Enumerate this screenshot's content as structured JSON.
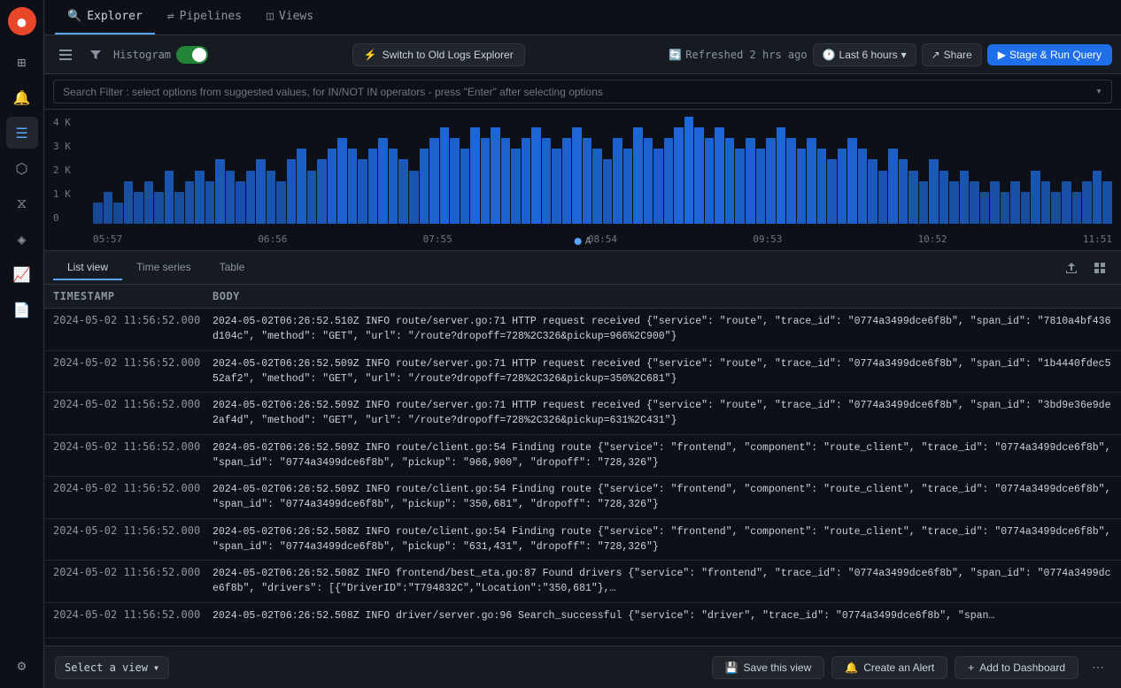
{
  "app": {
    "title": "Logs Explorer"
  },
  "sidebar": {
    "items": [
      {
        "id": "logo",
        "icon": "●",
        "label": "Logo"
      },
      {
        "id": "dashboard",
        "icon": "⊞",
        "label": "Dashboard"
      },
      {
        "id": "alerts",
        "icon": "🔔",
        "label": "Alerts"
      },
      {
        "id": "logs",
        "icon": "≡",
        "label": "Logs",
        "active": true
      },
      {
        "id": "metrics",
        "icon": "⬡",
        "label": "Metrics"
      },
      {
        "id": "traces",
        "icon": "⧖",
        "label": "Traces"
      },
      {
        "id": "analytics",
        "icon": "◈",
        "label": "Analytics"
      },
      {
        "id": "chart",
        "icon": "📈",
        "label": "Chart"
      },
      {
        "id": "docs",
        "icon": "📄",
        "label": "Docs"
      },
      {
        "id": "settings",
        "icon": "⚙",
        "label": "Settings"
      }
    ]
  },
  "top_tabs": [
    {
      "id": "explorer",
      "label": "Explorer",
      "icon": "🔍",
      "active": true
    },
    {
      "id": "pipelines",
      "label": "Pipelines",
      "icon": "⇌"
    },
    {
      "id": "views",
      "label": "Views",
      "icon": "◫"
    }
  ],
  "toolbar": {
    "histogram_label": "Histogram",
    "switch_btn": "Switch to Old Logs Explorer",
    "refresh_text": "Refreshed 2 hrs ago",
    "time_range": "Last 6 hours",
    "share_label": "Share",
    "run_query_label": "Stage & Run Query"
  },
  "search": {
    "placeholder": "Search Filter : select options from suggested values, for IN/NOT IN operators - press \"Enter\" after selecting options"
  },
  "histogram": {
    "y_labels": [
      "4 K",
      "3 K",
      "2 K",
      "1 K",
      "0"
    ],
    "x_labels": [
      "05:57",
      "06:56",
      "07:55",
      "08:54",
      "09:53",
      "10:52",
      "11:51"
    ],
    "legend_label": "A",
    "bars": [
      2,
      3,
      2,
      4,
      3,
      4,
      3,
      5,
      3,
      4,
      5,
      4,
      6,
      5,
      4,
      5,
      6,
      5,
      4,
      6,
      7,
      5,
      6,
      7,
      8,
      7,
      6,
      7,
      8,
      7,
      6,
      5,
      7,
      8,
      9,
      8,
      7,
      9,
      8,
      9,
      8,
      7,
      8,
      9,
      8,
      7,
      8,
      9,
      8,
      7,
      6,
      8,
      7,
      9,
      8,
      7,
      8,
      9,
      10,
      9,
      8,
      9,
      8,
      7,
      8,
      7,
      8,
      9,
      8,
      7,
      8,
      7,
      6,
      7,
      8,
      7,
      6,
      5,
      7,
      6,
      5,
      4,
      6,
      5,
      4,
      5,
      4,
      3,
      4,
      3,
      4,
      3,
      5,
      4,
      3,
      4,
      3,
      4,
      5,
      4
    ]
  },
  "view_tabs": [
    {
      "id": "list",
      "label": "List view",
      "active": true
    },
    {
      "id": "timeseries",
      "label": "Time series"
    },
    {
      "id": "table",
      "label": "Table"
    }
  ],
  "table": {
    "headers": [
      "Timestamp",
      "Body"
    ],
    "rows": [
      {
        "timestamp": "2024-05-02 11:56:52.000",
        "body": "2024-05-02T06:26:52.510Z INFO route/server.go:71 HTTP request received {\"service\": \"route\", \"trace_id\": \"0774a3499dce6f8b\", \"span_id\": \"7810a4bf436d104c\", \"method\": \"GET\", \"url\": \"/route?dropoff=728%2C326&pickup=966%2C900\"}"
      },
      {
        "timestamp": "2024-05-02 11:56:52.000",
        "body": "2024-05-02T06:26:52.509Z INFO route/server.go:71 HTTP request received {\"service\": \"route\", \"trace_id\": \"0774a3499dce6f8b\", \"span_id\": \"1b4440fdec552af2\", \"method\": \"GET\", \"url\": \"/route?dropoff=728%2C326&pickup=350%2C681\"}"
      },
      {
        "timestamp": "2024-05-02 11:56:52.000",
        "body": "2024-05-02T06:26:52.509Z INFO route/server.go:71 HTTP request received {\"service\": \"route\", \"trace_id\": \"0774a3499dce6f8b\", \"span_id\": \"3bd9e36e9de2af4d\", \"method\": \"GET\", \"url\": \"/route?dropoff=728%2C326&pickup=631%2C431\"}"
      },
      {
        "timestamp": "2024-05-02 11:56:52.000",
        "body": "2024-05-02T06:26:52.509Z INFO route/client.go:54 Finding route {\"service\": \"frontend\", \"component\": \"route_client\", \"trace_id\": \"0774a3499dce6f8b\", \"span_id\": \"0774a3499dce6f8b\", \"pickup\": \"966,900\", \"dropoff\": \"728,326\"}"
      },
      {
        "timestamp": "2024-05-02 11:56:52.000",
        "body": "2024-05-02T06:26:52.509Z INFO route/client.go:54 Finding route {\"service\": \"frontend\", \"component\": \"route_client\", \"trace_id\": \"0774a3499dce6f8b\", \"span_id\": \"0774a3499dce6f8b\", \"pickup\": \"350,681\", \"dropoff\": \"728,326\"}"
      },
      {
        "timestamp": "2024-05-02 11:56:52.000",
        "body": "2024-05-02T06:26:52.508Z INFO route/client.go:54 Finding route {\"service\": \"frontend\", \"component\": \"route_client\", \"trace_id\": \"0774a3499dce6f8b\", \"span_id\": \"0774a3499dce6f8b\", \"pickup\": \"631,431\", \"dropoff\": \"728,326\"}"
      },
      {
        "timestamp": "2024-05-02 11:56:52.000",
        "body": "2024-05-02T06:26:52.508Z INFO frontend/best_eta.go:87 Found drivers {\"service\": \"frontend\", \"trace_id\": \"0774a3499dce6f8b\", \"span_id\": \"0774a3499dce6f8b\", \"drivers\": [{\"DriverID\":\"T794832C\",\"Location\":\"350,681\"},…"
      },
      {
        "timestamp": "2024-05-02 11:56:52.000",
        "body": "2024-05-02T06:26:52.508Z INFO driver/server.go:96 Search_successful {\"service\": \"driver\", \"trace_id\": \"0774a3499dce6f8b\", \"span…"
      }
    ]
  },
  "bottom_bar": {
    "select_placeholder": "Select a view",
    "save_view_label": "Save this view",
    "create_alert_label": "Create an Alert",
    "add_dashboard_label": "Add to Dashboard"
  }
}
